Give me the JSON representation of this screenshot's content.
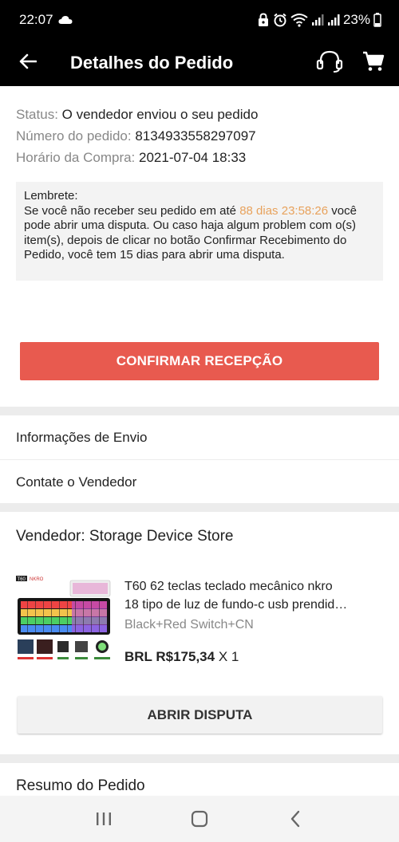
{
  "status_bar": {
    "time": "22:07",
    "battery": "23%",
    "icons": [
      "cloud-icon",
      "lock-icon",
      "alarm-icon",
      "wifi-icon",
      "signal-icon",
      "signal-icon",
      "battery-icon"
    ]
  },
  "app_bar": {
    "title": "Detalhes do Pedido",
    "back_icon": "arrow-left-icon",
    "support_icon": "headset-icon",
    "cart_icon": "cart-icon"
  },
  "order": {
    "status_label": "Status:",
    "status_value": "O vendedor enviou o seu pedido",
    "number_label": "Número do pedido:",
    "number_value": "8134933558297097",
    "date_label": "Horário da Compra:",
    "date_value": "2021-07-04 18:33"
  },
  "reminder": {
    "title": "Lembrete:",
    "text_before": "Se você não receber seu pedido em até ",
    "countdown": "88 dias 23:58:26",
    "text_after": "você pode abrir uma disputa. Ou caso haja algum problem com o(s) item(s), depois de clicar no botão Confirmar Recebimento do Pedido, você tem 15 dias para abrir uma disputa.",
    "highlight_color": "#e8a25c"
  },
  "confirm_button": "CONFIRMAR RECEPÇÃO",
  "links": {
    "shipping": "Informações de Envio",
    "contact": "Contate o Vendedor"
  },
  "seller": {
    "title": "Vendedor: Storage Device Store"
  },
  "product": {
    "title_line1": "T60 62 teclas teclado mecânico nkro",
    "title_line2": "18 tipo de luz de fundo-c usb prendid…",
    "variant": "Black+Red Switch+CN",
    "price": "BRL R$175,34",
    "quantity": "X 1",
    "image_labels": [
      "T60",
      "NKRO"
    ]
  },
  "dispute_button": "ABRIR DISPUTA",
  "summary": {
    "title": "Resumo do Pedido"
  },
  "nav_bar": {
    "icons": [
      "recent-apps-icon",
      "home-icon",
      "back-icon"
    ]
  },
  "colors": {
    "accent": "#e85a4f",
    "bar": "#000000"
  }
}
